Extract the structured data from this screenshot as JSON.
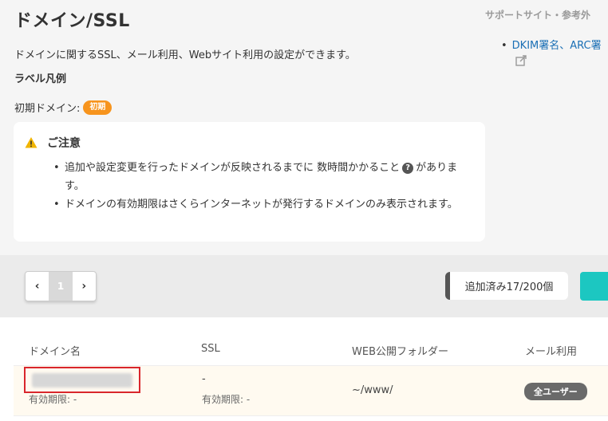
{
  "header": {
    "title": "ドメイン/SSL",
    "description": "ドメインに関するSSL、メール利用、Webサイト利用の設定ができます。"
  },
  "legend": {
    "title": "ラベル凡例",
    "initial_domain_label": "初期ドメイン:",
    "initial_badge": "初期"
  },
  "notice": {
    "title": "ご注意",
    "item1_before": "追加や設定変更を行ったドメインが反映されるまでに 数時間かかること",
    "item1_after": "があります。",
    "item2": "ドメインの有効期限はさくらインターネットが発行するドメインのみ表示されます。"
  },
  "sidebar": {
    "title": "サポートサイト・参考外",
    "link": "DKIM署名、ARC署"
  },
  "toolbar": {
    "page_prev": "‹",
    "page_current": "1",
    "page_next": "›",
    "count_text": "追加済み17/200個"
  },
  "table": {
    "columns": [
      "ドメイン名",
      "SSL",
      "WEB公開フォルダー",
      "メール利用"
    ],
    "rows": [
      {
        "domain_expiry": "有効期限: -",
        "ssl": "-",
        "ssl_expiry": "有効期限: -",
        "web_folder": "~/www/",
        "mail": "全ユーザー"
      }
    ]
  },
  "colors": {
    "badge_orange": "#f7941d",
    "accent_teal": "#1cc7c1",
    "link_blue": "#1a6fb5",
    "highlight_red": "#d9262c"
  }
}
